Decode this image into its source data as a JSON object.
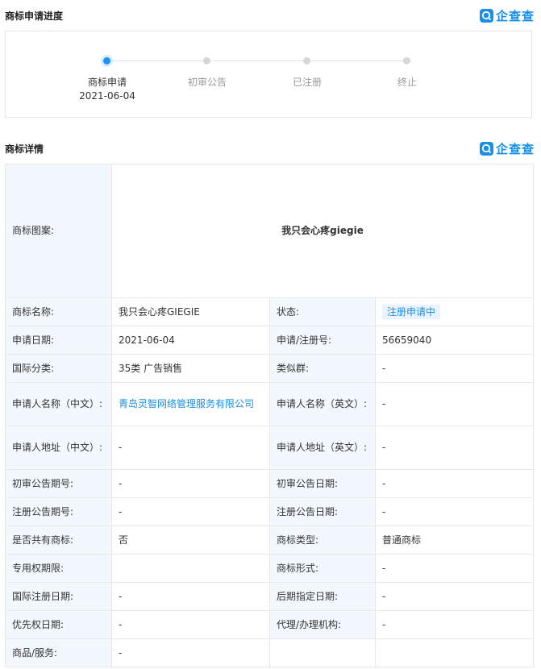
{
  "progress_section": {
    "title": "商标申请进度",
    "brand": "企查查",
    "steps": [
      {
        "label": "商标申请",
        "date": "2021-06-04",
        "active": true
      },
      {
        "label": "初审公告",
        "date": "",
        "active": false
      },
      {
        "label": "已注册",
        "date": "",
        "active": false
      },
      {
        "label": "终止",
        "date": "",
        "active": false
      }
    ]
  },
  "detail_section": {
    "title": "商标详情",
    "brand": "企查查",
    "pattern_label": "商标图案:",
    "pattern_text": "我只会心疼giegie",
    "rows": [
      [
        "商标名称:",
        "我只会心疼GIEGIE",
        "状态:",
        "注册申请中"
      ],
      [
        "申请日期:",
        "2021-06-04",
        "申请/注册号:",
        "56659040"
      ],
      [
        "国际分类:",
        "35类 广告销售",
        "类似群:",
        "-"
      ],
      [
        "申请人名称（中文）:",
        "青岛灵智网络管理服务有限公司",
        "申请人名称（英文）:",
        "-"
      ],
      [
        "申请人地址（中文）:",
        "-",
        "申请人地址（英文）:",
        "-"
      ],
      [
        "初审公告期号:",
        "-",
        "初审公告日期:",
        "-"
      ],
      [
        "注册公告期号:",
        "-",
        "注册公告日期:",
        "-"
      ],
      [
        "是否共有商标:",
        "否",
        "商标类型:",
        "普通商标"
      ],
      [
        "专用权期限:",
        "",
        "商标形式:",
        "-"
      ],
      [
        "国际注册日期:",
        "-",
        "后期指定日期:",
        "-"
      ],
      [
        "优先权日期:",
        "-",
        "代理/办理机构:",
        "-"
      ],
      [
        "商品/服务:",
        "-",
        "",
        ""
      ]
    ]
  },
  "colors": {
    "accent": "#1a8fe8",
    "key_bg": "#f2f8fe"
  }
}
